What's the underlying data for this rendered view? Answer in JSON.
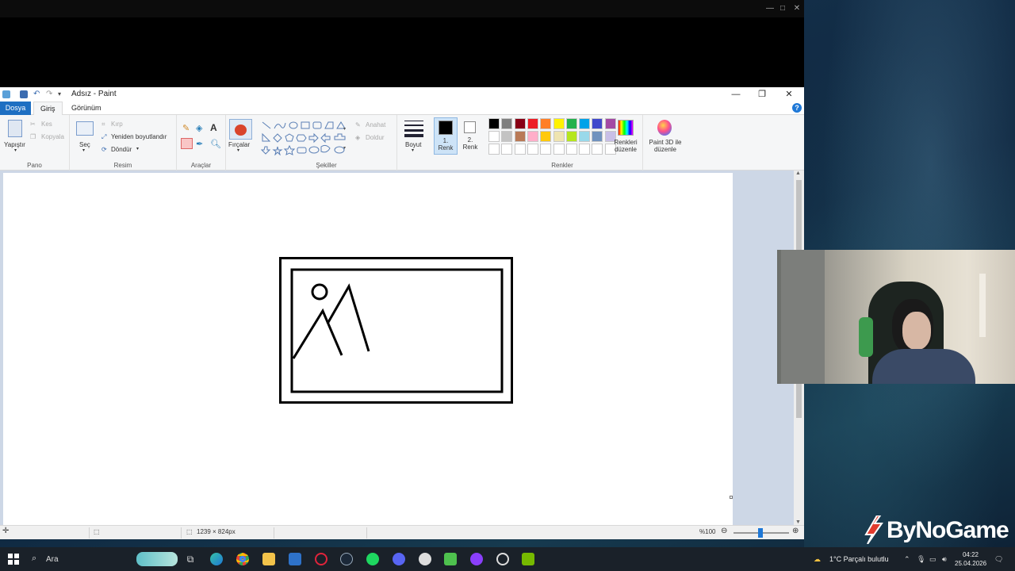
{
  "paint": {
    "title": "Adsız - Paint",
    "tabs": {
      "dosya": "Dosya",
      "giris": "Giriş",
      "gorunum": "Görünüm"
    },
    "ribbon": {
      "pano": {
        "label": "Pano",
        "paste": "Yapıştır",
        "cut": "Kes",
        "copy": "Kopyala"
      },
      "resim": {
        "label": "Resim",
        "select": "Seç",
        "crop": "Kırp",
        "resize": "Yeniden boyutlandır",
        "rotate": "Döndür"
      },
      "araclar": {
        "label": "Araçlar"
      },
      "brushes": "Fırçalar",
      "sekiller": {
        "label": "Şekiller",
        "outline": "Anahat",
        "fill": "Doldur"
      },
      "size": "Boyut",
      "color1": "1. Renk",
      "color2": "2. Renk",
      "renkler": {
        "label": "Renkler",
        "edit": "Renkleri düzenle"
      },
      "paint3d": "Paint 3D ile düzenle"
    },
    "palette": [
      "#000000",
      "#7f7f7f",
      "#880015",
      "#ed1c24",
      "#ff7f27",
      "#fff200",
      "#22b14c",
      "#00a2e8",
      "#3f48cc",
      "#a349a4",
      "#ffffff",
      "#c3c3c3",
      "#b97a57",
      "#ffaec9",
      "#ffc90e",
      "#efe4b0",
      "#b5e61d",
      "#99d9ea",
      "#7092be",
      "#c8bfe7"
    ],
    "status": {
      "canvas_size": "1239 × 824px",
      "zoom": "%100"
    }
  },
  "logo": {
    "text": "ByNoGame"
  },
  "taskbar": {
    "search": "Ara",
    "weather": "1°C  Parçalı bulutlu",
    "time": "04:22",
    "date": "25.04.2026"
  }
}
